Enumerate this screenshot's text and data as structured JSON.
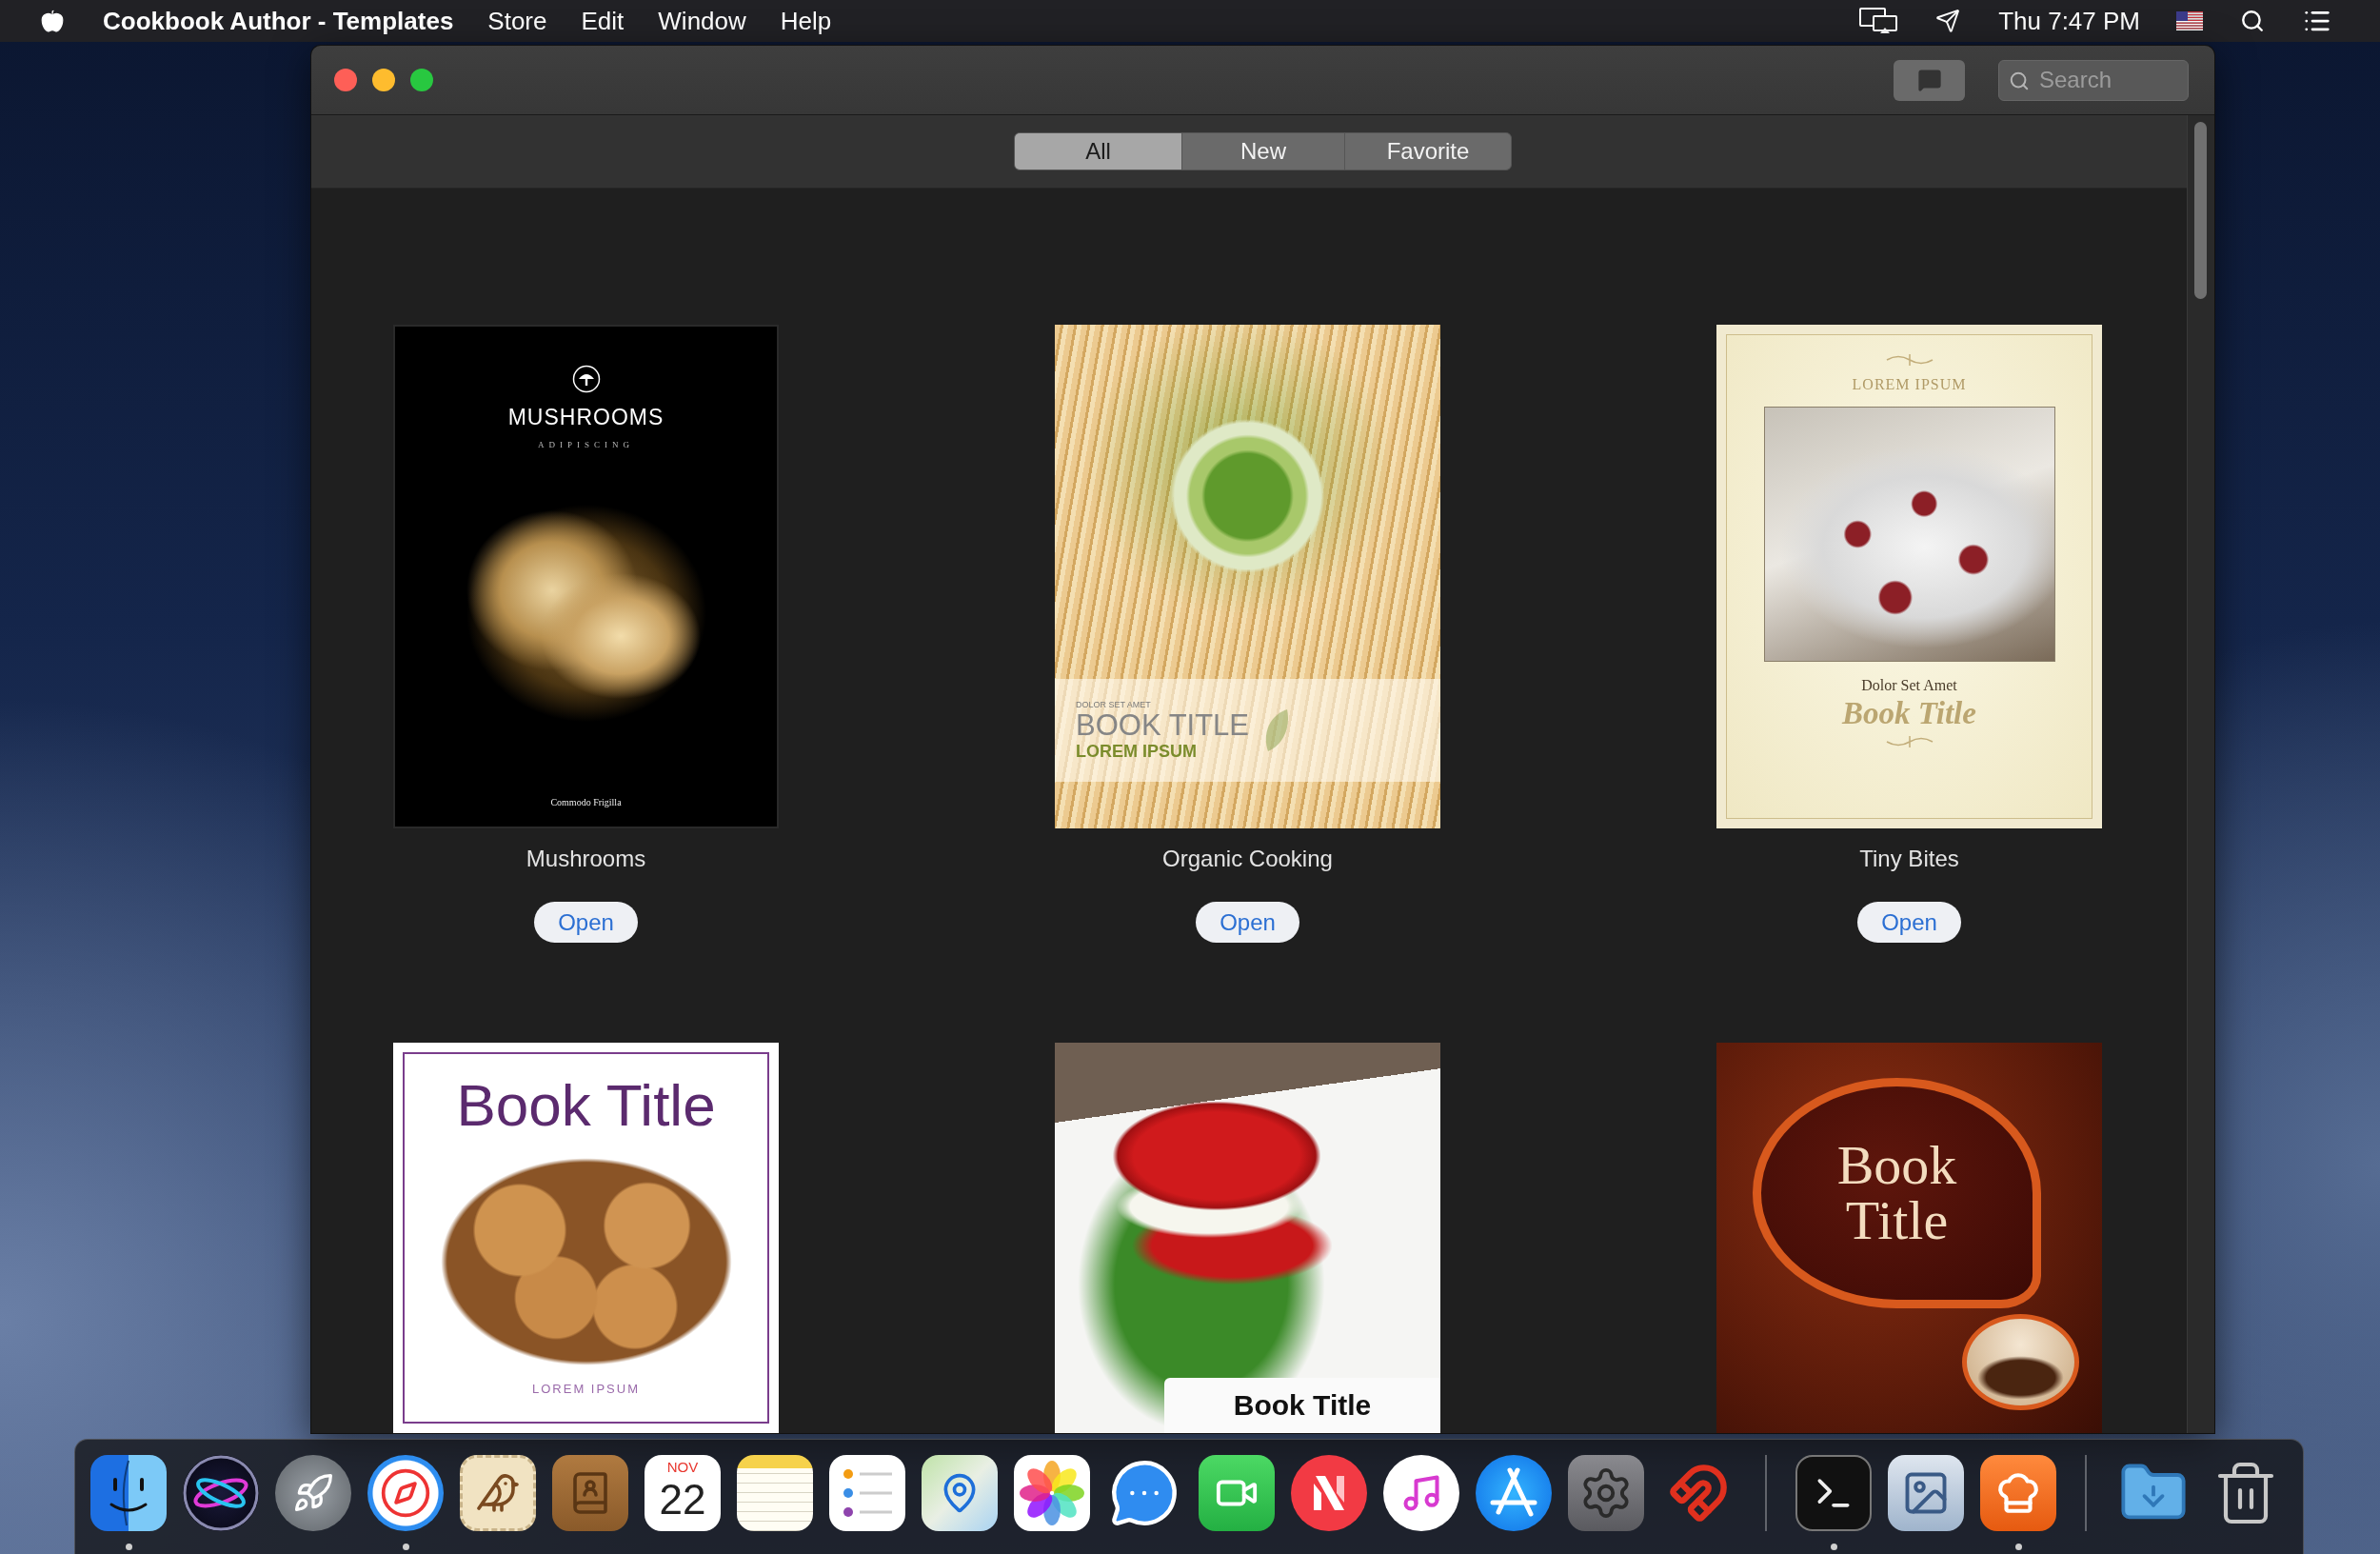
{
  "menu_bar": {
    "app_name": "Cookbook Author - Templates",
    "menus": [
      "Store",
      "Edit",
      "Window",
      "Help"
    ],
    "clock": "Thu 7:47 PM"
  },
  "toolbar": {
    "search": {
      "placeholder": "Search"
    }
  },
  "filter_tabs": [
    {
      "label": "All",
      "selected": true
    },
    {
      "label": "New",
      "selected": false
    },
    {
      "label": "Favorite",
      "selected": false
    }
  ],
  "templates": [
    {
      "name": "Mushrooms",
      "button": "Open",
      "cover": {
        "kind": "mushrooms",
        "title": "MUSHROOMS",
        "subtitle": "ADIPISCING",
        "author": "Commodo Frigilla"
      }
    },
    {
      "name": "Organic Cooking",
      "button": "Open",
      "cover": {
        "kind": "organic",
        "kicker": "DOLOR SET AMET",
        "title": "BOOK TITLE",
        "subtitle": "LOREM IPSUM"
      }
    },
    {
      "name": "Tiny Bites",
      "button": "Open",
      "cover": {
        "kind": "tiny-bites",
        "kicker": "LOREM IPSUM",
        "subtitle": "Dolor Set Amet",
        "title": "Book Title"
      }
    },
    {
      "cover": {
        "kind": "cookies",
        "title": "Book Title",
        "subtitle": "LOREM IPSUM"
      }
    },
    {
      "cover": {
        "kind": "tomato",
        "title": "Book Title"
      }
    },
    {
      "cover": {
        "kind": "coffee",
        "title": "Book Title"
      }
    }
  ],
  "dock": {
    "groups": [
      [
        {
          "running": true
        },
        {
          "running": false
        },
        {
          "running": false
        },
        {
          "running": true
        },
        {
          "running": false
        },
        {
          "running": false
        },
        {
          "running": false,
          "month": "NOV",
          "day": "22"
        },
        {
          "running": false
        },
        {
          "running": false
        },
        {
          "running": false
        },
        {
          "running": false
        },
        {
          "running": false
        },
        {
          "running": false
        },
        {
          "running": false
        },
        {
          "running": false
        },
        {
          "running": false
        },
        {
          "running": false
        },
        {
          "running": false
        }
      ],
      [
        {
          "running": true
        },
        {
          "running": false
        },
        {
          "running": true
        }
      ],
      [
        {
          "running": false
        },
        {
          "running": false
        }
      ]
    ]
  }
}
